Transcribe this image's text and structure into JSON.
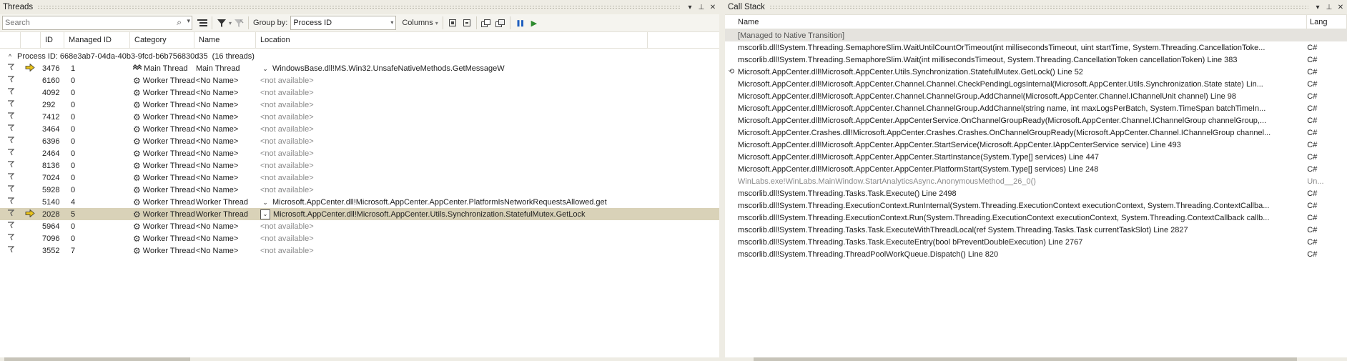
{
  "threads": {
    "title": "Threads",
    "search_placeholder": "Search",
    "group_by_label": "Group by:",
    "group_by_value": "Process ID",
    "columns_label": "Columns",
    "headers": [
      "ID",
      "Managed ID",
      "Category",
      "Name",
      "Location"
    ],
    "group_header": "Process ID: 668e3ab7-04da-40b3-9fcd-b6b756830d35",
    "group_count": "(16 threads)",
    "rows": [
      {
        "id": "3476",
        "mid": "1",
        "cat": "Main Thread",
        "name": "Main Thread",
        "loc": "WindowsBase.dll!MS.Win32.UnsafeNativeMethods.GetMessageW",
        "avail": true,
        "expand": true,
        "arrow": true,
        "sel": false,
        "main": true
      },
      {
        "id": "6160",
        "mid": "0",
        "cat": "Worker Thread",
        "name": "<No Name>",
        "loc": "<not available>",
        "avail": false
      },
      {
        "id": "4092",
        "mid": "0",
        "cat": "Worker Thread",
        "name": "<No Name>",
        "loc": "<not available>",
        "avail": false
      },
      {
        "id": "292",
        "mid": "0",
        "cat": "Worker Thread",
        "name": "<No Name>",
        "loc": "<not available>",
        "avail": false
      },
      {
        "id": "7412",
        "mid": "0",
        "cat": "Worker Thread",
        "name": "<No Name>",
        "loc": "<not available>",
        "avail": false
      },
      {
        "id": "3464",
        "mid": "0",
        "cat": "Worker Thread",
        "name": "<No Name>",
        "loc": "<not available>",
        "avail": false
      },
      {
        "id": "6396",
        "mid": "0",
        "cat": "Worker Thread",
        "name": "<No Name>",
        "loc": "<not available>",
        "avail": false
      },
      {
        "id": "2464",
        "mid": "0",
        "cat": "Worker Thread",
        "name": "<No Name>",
        "loc": "<not available>",
        "avail": false
      },
      {
        "id": "8136",
        "mid": "0",
        "cat": "Worker Thread",
        "name": "<No Name>",
        "loc": "<not available>",
        "avail": false
      },
      {
        "id": "7024",
        "mid": "0",
        "cat": "Worker Thread",
        "name": "<No Name>",
        "loc": "<not available>",
        "avail": false
      },
      {
        "id": "5928",
        "mid": "0",
        "cat": "Worker Thread",
        "name": "<No Name>",
        "loc": "<not available>",
        "avail": false
      },
      {
        "id": "5140",
        "mid": "4",
        "cat": "Worker Thread",
        "name": "Worker Thread",
        "loc": "Microsoft.AppCenter.dll!Microsoft.AppCenter.AppCenter.PlatformIsNetworkRequestsAllowed.get",
        "avail": true,
        "expand": true
      },
      {
        "id": "2028",
        "mid": "5",
        "cat": "Worker Thread",
        "name": "Worker Thread",
        "loc": "Microsoft.AppCenter.dll!Microsoft.AppCenter.Utils.Synchronization.StatefulMutex.GetLock",
        "avail": true,
        "expand": true,
        "arrow": true,
        "sel": true,
        "box": true
      },
      {
        "id": "5964",
        "mid": "0",
        "cat": "Worker Thread",
        "name": "<No Name>",
        "loc": "<not available>",
        "avail": false
      },
      {
        "id": "7096",
        "mid": "0",
        "cat": "Worker Thread",
        "name": "<No Name>",
        "loc": "<not available>",
        "avail": false
      },
      {
        "id": "3552",
        "mid": "7",
        "cat": "Worker Thread",
        "name": "<No Name>",
        "loc": "<not available>",
        "avail": false
      }
    ]
  },
  "callstack": {
    "title": "Call Stack",
    "headers": [
      "Name",
      "Lang"
    ],
    "frames": [
      {
        "name": "[Managed to Native Transition]",
        "lang": "",
        "gray": false,
        "first": true
      },
      {
        "name": "mscorlib.dll!System.Threading.SemaphoreSlim.WaitUntilCountOrTimeout(int millisecondsTimeout, uint startTime, System.Threading.CancellationToke...",
        "lang": "C#"
      },
      {
        "name": "mscorlib.dll!System.Threading.SemaphoreSlim.Wait(int millisecondsTimeout, System.Threading.CancellationToken cancellationToken) Line 383",
        "lang": "C#"
      },
      {
        "name": "Microsoft.AppCenter.dll!Microsoft.AppCenter.Utils.Synchronization.StatefulMutex.GetLock() Line 52",
        "lang": "C#",
        "icon": true
      },
      {
        "name": "Microsoft.AppCenter.dll!Microsoft.AppCenter.Channel.Channel.CheckPendingLogsInternal(Microsoft.AppCenter.Utils.Synchronization.State state) Lin...",
        "lang": "C#"
      },
      {
        "name": "Microsoft.AppCenter.dll!Microsoft.AppCenter.Channel.ChannelGroup.AddChannel(Microsoft.AppCenter.Channel.IChannelUnit channel) Line 98",
        "lang": "C#"
      },
      {
        "name": "Microsoft.AppCenter.dll!Microsoft.AppCenter.Channel.ChannelGroup.AddChannel(string name, int maxLogsPerBatch, System.TimeSpan batchTimeIn...",
        "lang": "C#"
      },
      {
        "name": "Microsoft.AppCenter.dll!Microsoft.AppCenter.AppCenterService.OnChannelGroupReady(Microsoft.AppCenter.Channel.IChannelGroup channelGroup,...",
        "lang": "C#"
      },
      {
        "name": "Microsoft.AppCenter.Crashes.dll!Microsoft.AppCenter.Crashes.Crashes.OnChannelGroupReady(Microsoft.AppCenter.Channel.IChannelGroup channel...",
        "lang": "C#"
      },
      {
        "name": "Microsoft.AppCenter.dll!Microsoft.AppCenter.AppCenter.StartService(Microsoft.AppCenter.IAppCenterService service) Line 493",
        "lang": "C#"
      },
      {
        "name": "Microsoft.AppCenter.dll!Microsoft.AppCenter.AppCenter.StartInstance(System.Type[] services) Line 447",
        "lang": "C#"
      },
      {
        "name": "Microsoft.AppCenter.dll!Microsoft.AppCenter.AppCenter.PlatformStart(System.Type[] services) Line 248",
        "lang": "C#"
      },
      {
        "name": "WinLabs.exe!WinLabs.MainWindow.StartAnalyticsAsync.AnonymousMethod__26_0()",
        "lang": "Un...",
        "gray": true
      },
      {
        "name": "mscorlib.dll!System.Threading.Tasks.Task.Execute() Line 2498",
        "lang": "C#"
      },
      {
        "name": "mscorlib.dll!System.Threading.ExecutionContext.RunInternal(System.Threading.ExecutionContext executionContext, System.Threading.ContextCallba...",
        "lang": "C#"
      },
      {
        "name": "mscorlib.dll!System.Threading.ExecutionContext.Run(System.Threading.ExecutionContext executionContext, System.Threading.ContextCallback callb...",
        "lang": "C#"
      },
      {
        "name": "mscorlib.dll!System.Threading.Tasks.Task.ExecuteWithThreadLocal(ref System.Threading.Tasks.Task currentTaskSlot) Line 2827",
        "lang": "C#"
      },
      {
        "name": "mscorlib.dll!System.Threading.Tasks.Task.ExecuteEntry(bool bPreventDoubleExecution) Line 2767",
        "lang": "C#"
      },
      {
        "name": "mscorlib.dll!System.Threading.ThreadPoolWorkQueue.Dispatch() Line 820",
        "lang": "C#"
      }
    ]
  },
  "icons": {
    "window_menu": "▾",
    "pin": "⊥",
    "close": "✕",
    "search": "⌕",
    "filter": "⛛",
    "flag": "⛉",
    "expand_group": "^",
    "expand_row": "⌄",
    "current_arrow": "⇨",
    "gear": "⚙",
    "pause": "❚❚",
    "play": "▶",
    "frame_marker": "⟲"
  },
  "colors": {
    "selection": "#d9d2b8",
    "arrow_yellow": "#e8c21a",
    "accent_blue": "#1f5fbf",
    "play_green": "#2e8b2e"
  }
}
